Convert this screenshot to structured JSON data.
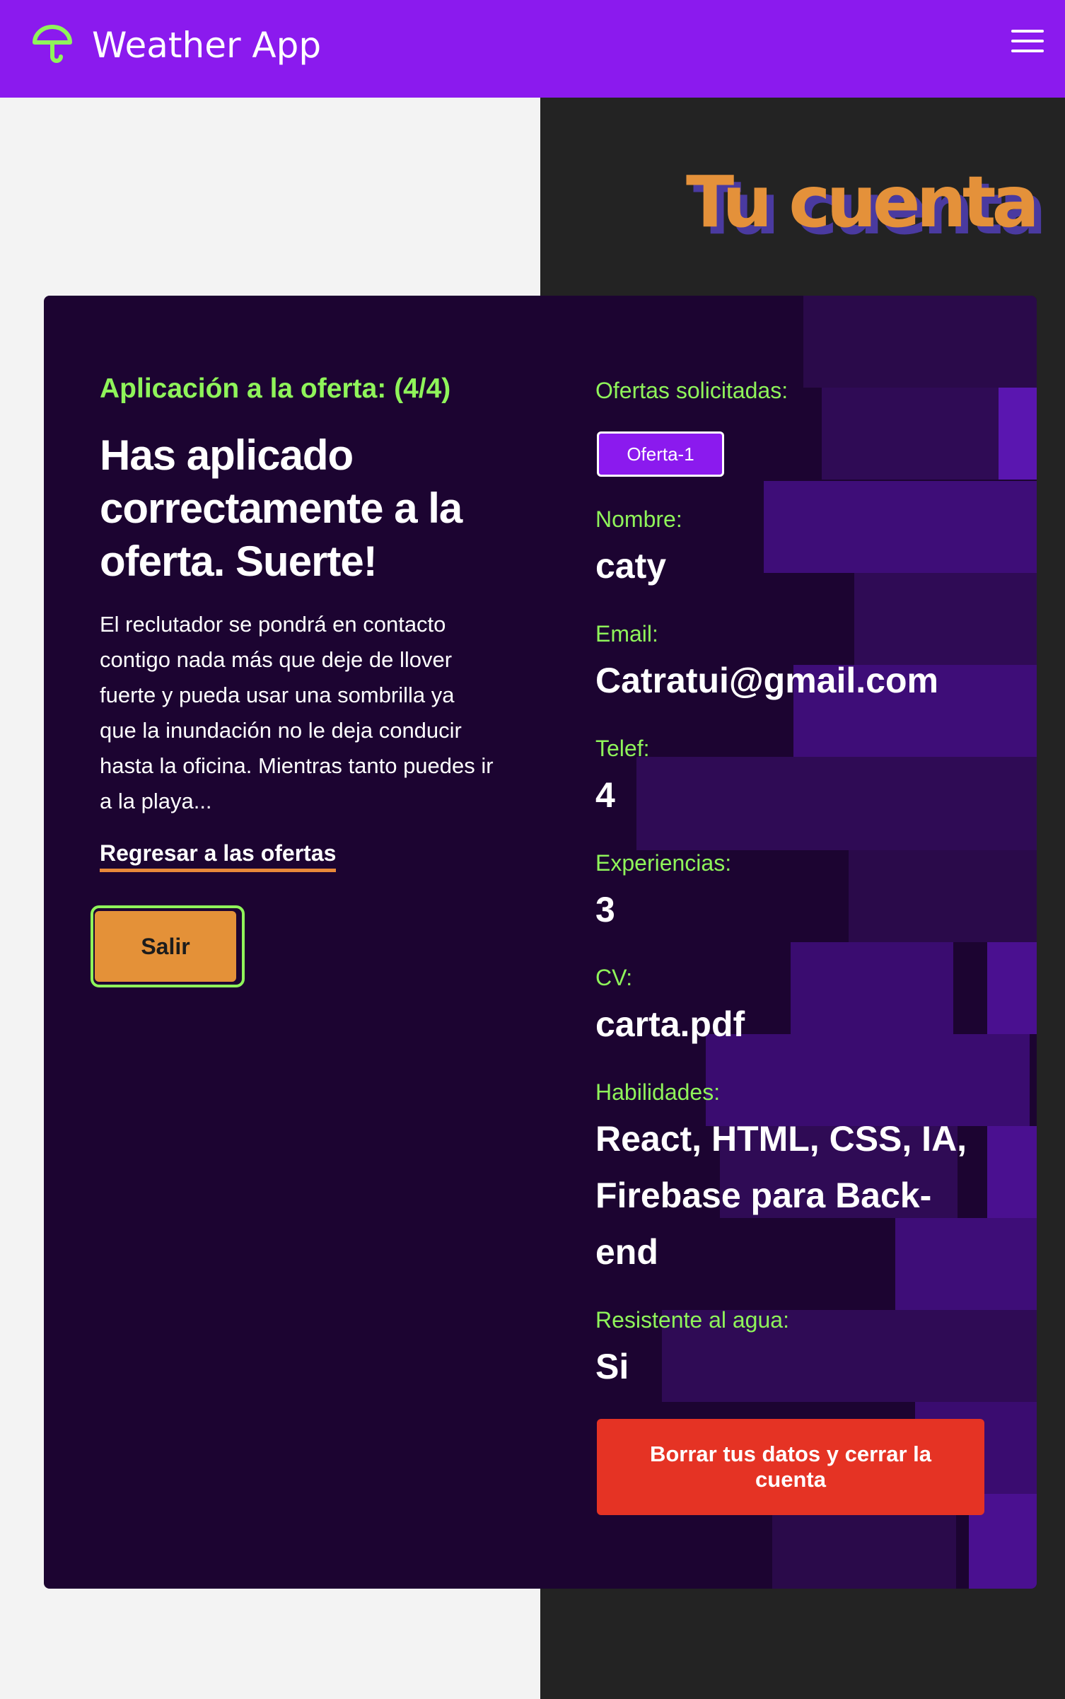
{
  "header": {
    "app_title": "Weather App",
    "logo_icon": "umbrella-icon",
    "menu_icon": "hamburger-menu-icon",
    "accent_color": "#8b1aee",
    "logo_color": "#8ff45a"
  },
  "page": {
    "title": "Tu cuenta",
    "title_color": "#e4913a",
    "title_shadow_color": "#4a3aa0"
  },
  "application": {
    "step": "Aplicación a la oferta: (4/4)",
    "headline": "Has aplicado correctamente a la oferta. Suerte!",
    "description": "El reclutador se pondrá en contacto contigo nada más que deje de llover fuerte y pueda usar una sombrilla ya que la inundación no le deja conducir hasta la oficina. Mientras tanto puedes ir a la playa...",
    "back_link": "Regresar a las ofertas",
    "exit_button": "Salir"
  },
  "account": {
    "offers_label": "Ofertas solicitadas:",
    "offers": [
      "Oferta-1"
    ],
    "name_label": "Nombre:",
    "name": "caty",
    "email_label": "Email:",
    "email": "Catratui@gmail.com",
    "phone_label": "Telef:",
    "phone": "4",
    "experience_label": "Experiencias:",
    "experience": "3",
    "cv_label": "CV:",
    "cv": "carta.pdf",
    "skills_label": "Habilidades:",
    "skills": "React, HTML, CSS, IA, Firebase para Back-end",
    "waterproof_label": "Resistente al agua:",
    "waterproof": "Si",
    "delete_button": "Borrar tus datos y cerrar la cuenta",
    "delete_color": "#e53324"
  }
}
